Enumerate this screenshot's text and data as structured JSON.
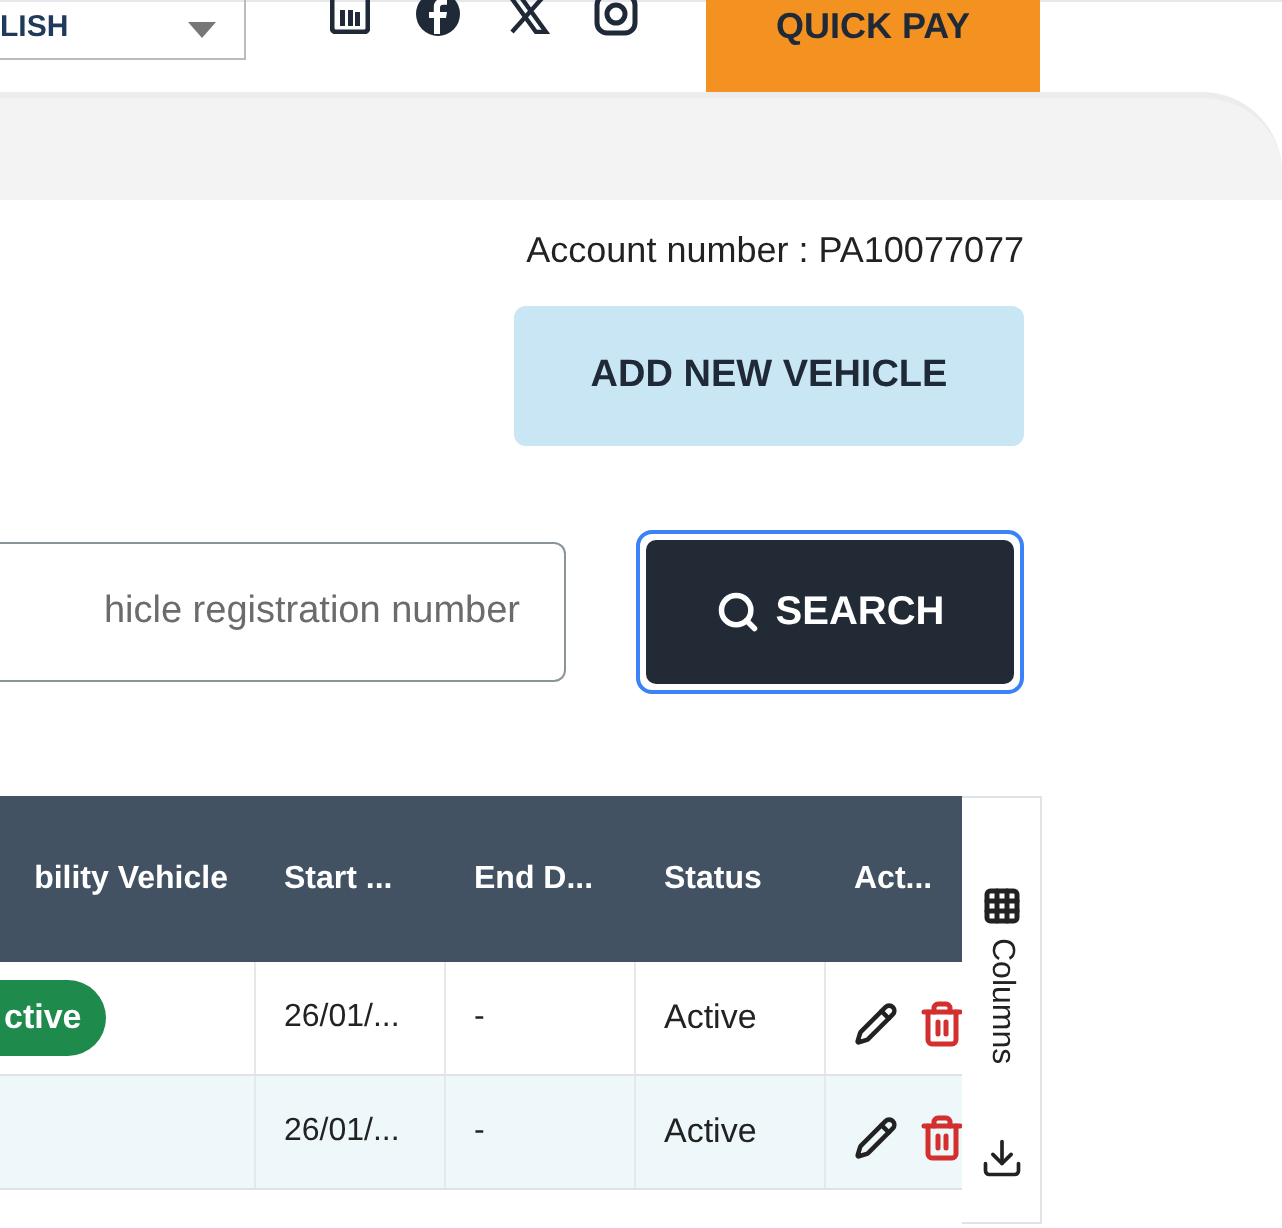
{
  "header": {
    "language": "LISH",
    "quick_pay": "QUICK PAY"
  },
  "account": {
    "label": "Account number : PA10077077"
  },
  "add_button": "ADD NEW VEHICLE",
  "search": {
    "placeholder": "hicle registration number",
    "button": "SEARCH"
  },
  "table": {
    "columns": [
      "bility Vehicle",
      "Start ...",
      "End D...",
      "Status",
      "Act..."
    ],
    "rows": [
      {
        "badge": "ctive",
        "start": "26/01/...",
        "end": "-",
        "status": "Active",
        "selected": false
      },
      {
        "badge": "",
        "start": "26/01/...",
        "end": "-",
        "status": "Active",
        "selected": true
      }
    ]
  },
  "side_panel": {
    "columns_label": "Columns"
  }
}
